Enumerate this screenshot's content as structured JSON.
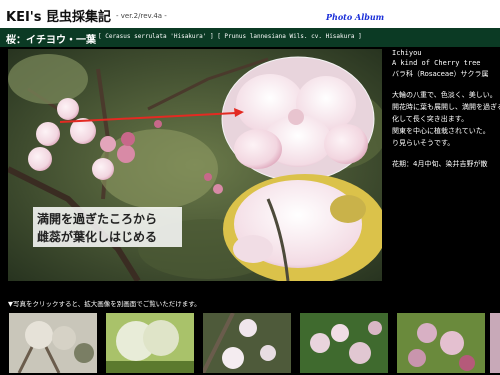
{
  "header": {
    "logo": "KEI's 昆虫採集記",
    "version": "- ver.2/rev.4a -",
    "album": "Photo Album"
  },
  "title": {
    "japanese": "桜：イチヨウ・一葉",
    "scientific": "[ Cerasus serrulata 'Hisakura' ] [ Prunus lannesiana Wils. cv. Hisakura ]"
  },
  "photo": {
    "caption_line1": "満開を過ぎたころから",
    "caption_line2": "雌蕊が葉化しはじめる"
  },
  "info": {
    "name_jp": "Ichiyou",
    "name_en": "A kind of Cherry tree",
    "family": "バラ科（Rosaceae）サクラ属",
    "desc1": "大輪の八重で、色淡く、美しい。",
    "desc2": "開花時に葉も展開し、満開を過ぎると",
    "desc3": "化して長く突き出ます。",
    "desc4": "関東を中心に植栽されていた。",
    "desc5": "り見らいそうです。",
    "bloom": "花期：4月中旬、染井吉野が散"
  },
  "gallery": {
    "notice": "▼写真をクリックすると、拡大画像を別画面でご覧いただけます。",
    "thumbnails": [
      {
        "name": "thumb-1",
        "color": "#c9c6ba"
      },
      {
        "name": "thumb-2",
        "color": "#a9c26a"
      },
      {
        "name": "thumb-3",
        "color": "#4e5a3a"
      },
      {
        "name": "thumb-4",
        "color": "#3f6a2e"
      },
      {
        "name": "thumb-5",
        "color": "#d8b0c4"
      }
    ]
  },
  "colors": {
    "title_bar": "#0b3a24",
    "album_link": "#1a2fd8",
    "arrow": "#e32a22"
  }
}
